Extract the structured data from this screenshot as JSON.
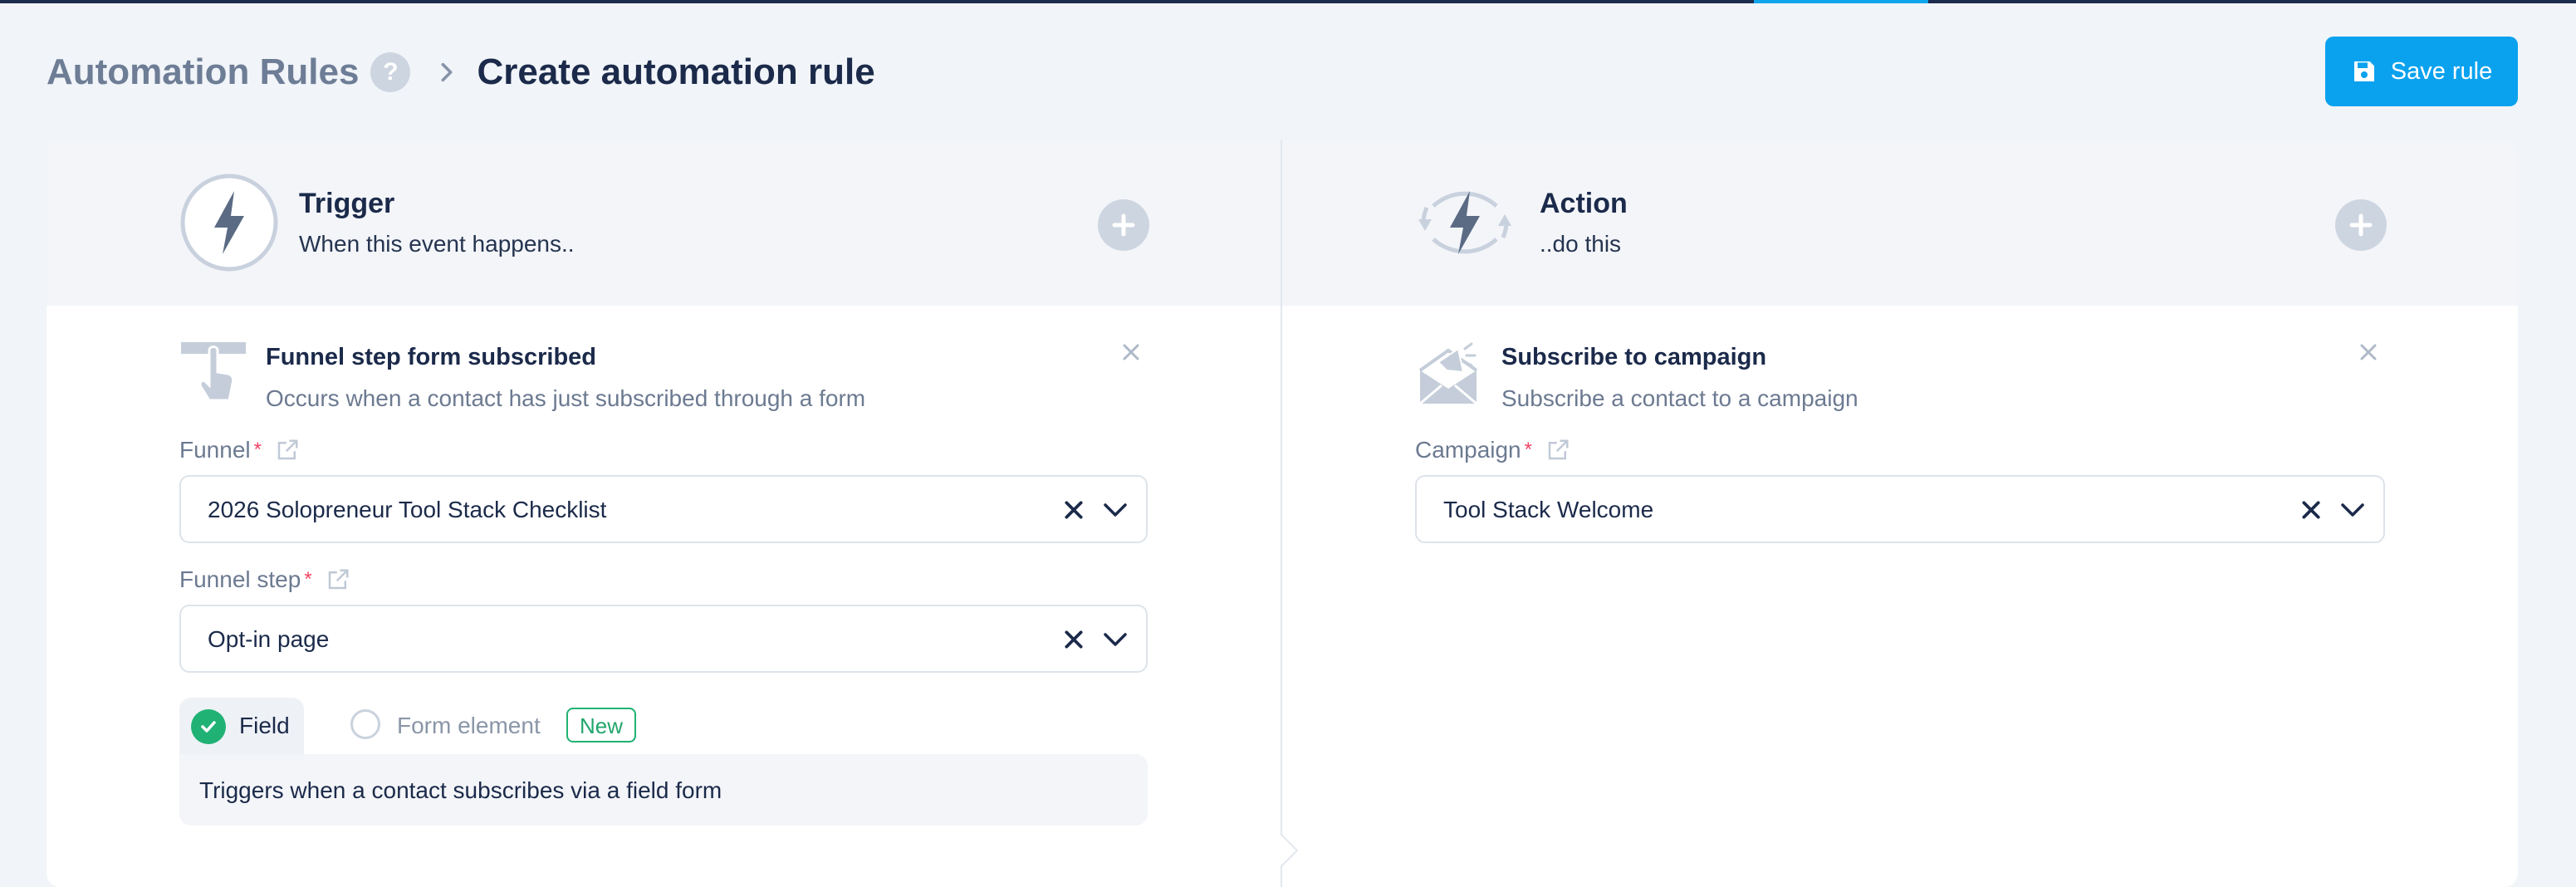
{
  "header": {
    "breadcrumb_parent": "Automation Rules",
    "help_glyph": "?",
    "page_title": "Create automation rule",
    "save_label": "Save rule"
  },
  "top_progress": {
    "value_percent": null
  },
  "trigger": {
    "heading": "Trigger",
    "subheading": "When this event happens..",
    "item": {
      "title": "Funnel step form subscribed",
      "description": "Occurs when a contact has just subscribed through a form"
    },
    "funnel": {
      "label": "Funnel",
      "required_mark": "*",
      "value": "2026 Solopreneur Tool Stack Checklist"
    },
    "funnel_step": {
      "label": "Funnel step",
      "required_mark": "*",
      "value": "Opt-in page"
    },
    "options": {
      "field_label": "Field",
      "form_element_label": "Form element",
      "new_badge": "New",
      "selected": "Field",
      "description": "Triggers when a contact subscribes via a field form"
    }
  },
  "action": {
    "heading": "Action",
    "subheading": "..do this",
    "item": {
      "title": "Subscribe to campaign",
      "description": "Subscribe a contact to a campaign"
    },
    "campaign": {
      "label": "Campaign",
      "required_mark": "*",
      "value": "Tool Stack Welcome"
    }
  },
  "colors": {
    "accent": "#0aa2ef",
    "success": "#20b274",
    "required": "#ef4464",
    "navy": "#1c2b4e"
  },
  "icons": [
    "help-icon",
    "chevron-right-icon",
    "save-icon",
    "lightning-bolt-icon",
    "plus-icon",
    "hand-pointer-icon",
    "megaphone-envelope-icon",
    "close-icon",
    "external-link-icon",
    "clear-icon",
    "chevron-down-icon",
    "check-icon"
  ]
}
